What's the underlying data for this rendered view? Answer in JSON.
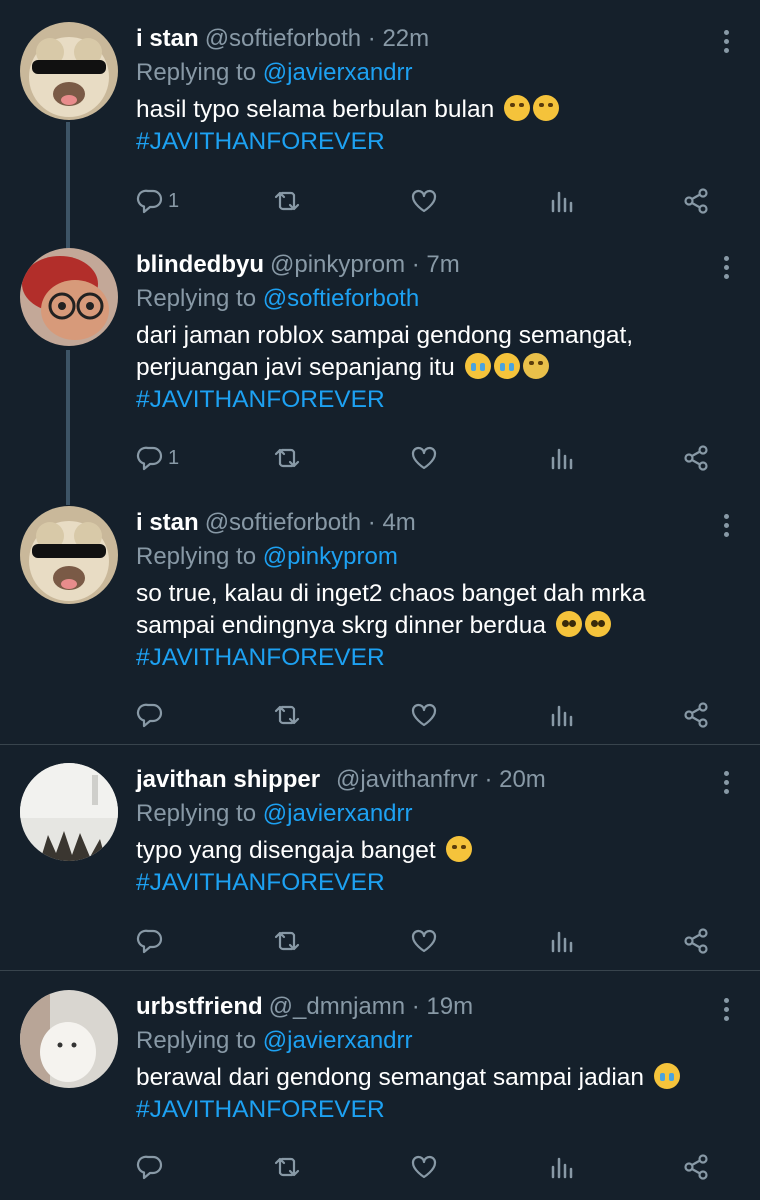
{
  "tweets": [
    {
      "name": "i stan",
      "handle": "@softieforboth · 22m",
      "replying_prefix": "Replying to ",
      "replying_to": "@javierxandrr",
      "lines": [
        "hasil typo selama berbulan bulan"
      ],
      "hashtag": "#JAVITHANFOREVER",
      "reply_count": "1",
      "emoji": [
        "rolling-on-floor-laughing",
        "rolling-on-floor-laughing"
      ]
    },
    {
      "name": "blindedbyu",
      "handle": "@pinkyprom · 7m",
      "replying_prefix": "Replying to ",
      "replying_to": "@softieforboth",
      "lines": [
        "dari jaman roblox sampai gendong semangat,",
        "perjuangan javi sepanjang itu"
      ],
      "hashtag": "#JAVITHANFOREVER",
      "reply_count": "1",
      "emoji": [
        "loudly-crying",
        "loudly-crying",
        "sneezing"
      ]
    },
    {
      "name": "i stan",
      "handle": "@softieforboth · 4m",
      "replying_prefix": "Replying to ",
      "replying_to": "@pinkyprom",
      "lines": [
        "so true, kalau di inget2 chaos banget dah mrka",
        "sampai endingnya skrg dinner berdua"
      ],
      "hashtag": "#JAVITHANFOREVER",
      "reply_count": "",
      "emoji": [
        "pleading",
        "pleading"
      ]
    },
    {
      "name": "javithan shipper",
      "handle": "@javithanfrvr · 20m",
      "replying_prefix": "Replying to ",
      "replying_to": "@javierxandrr",
      "lines": [
        "typo yang disengaja banget"
      ],
      "hashtag": "#JAVITHANFOREVER",
      "reply_count": "",
      "emoji": [
        "hand-over-mouth"
      ]
    },
    {
      "name": "urbstfriend",
      "handle": "@_dmnjamn · 19m",
      "replying_prefix": "Replying to ",
      "replying_to": "@javierxandrr",
      "lines": [
        "berawal dari gendong semangat sampai jadian"
      ],
      "hashtag": "#JAVITHANFOREVER",
      "reply_count": "",
      "emoji": [
        "loudly-crying"
      ]
    }
  ],
  "icons": {
    "reply": "reply-icon",
    "retweet": "retweet-icon",
    "like": "heart-icon",
    "analytics": "analytics-icon",
    "share": "share-icon",
    "more": "more-icon"
  },
  "colors": {
    "background": "#15202b",
    "accent": "#1da1f2",
    "secondary_text": "#8899a6",
    "divider": "#38444d"
  }
}
